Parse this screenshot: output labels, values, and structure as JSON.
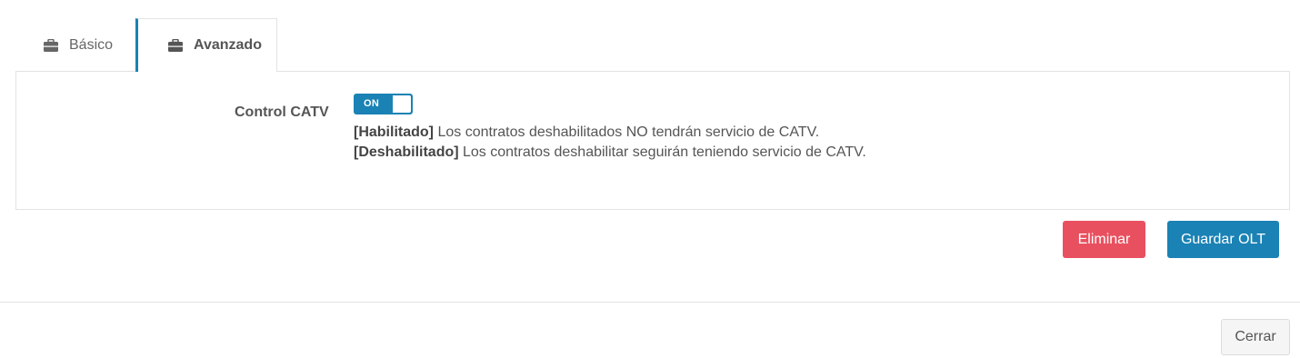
{
  "tabs": [
    {
      "label": "Básico",
      "icon": "briefcase-icon",
      "active": false
    },
    {
      "label": "Avanzado",
      "icon": "briefcase-icon",
      "active": true
    }
  ],
  "field": {
    "label": "Control CATV",
    "toggle_text": "ON",
    "toggle_state": true
  },
  "help": {
    "line1_bold": "[Habilitado]",
    "line1_text": " Los contratos deshabilitados NO tendrán servicio de CATV.",
    "line2_bold": "[Deshabilitado]",
    "line2_text": " Los contratos deshabilitar seguirán teniendo servicio de CATV."
  },
  "actions": {
    "delete_label": "Eliminar",
    "save_label": "Guardar OLT",
    "close_label": "Cerrar"
  },
  "colors": {
    "primary": "#1a82b4",
    "danger": "#e9505f"
  }
}
